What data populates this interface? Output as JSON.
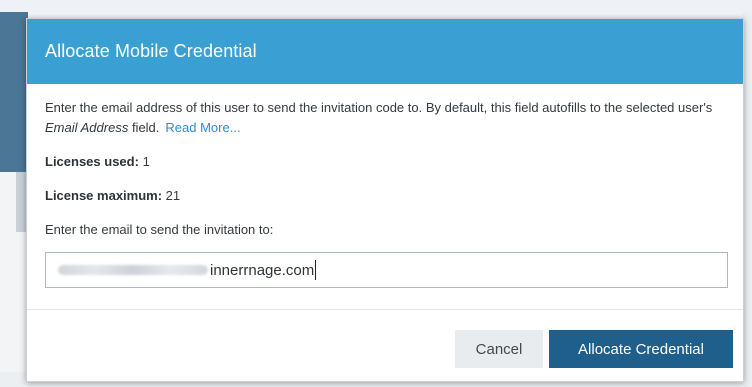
{
  "modal": {
    "title": "Allocate Mobile Credential",
    "description": {
      "text_before": "Enter the email address of this user to send the invitation code to. By default, this field autofills to the selected user's ",
      "emphasis": "Email Address",
      "text_after": " field.",
      "link": "Read More..."
    },
    "licenses_used": {
      "label": "Licenses used:",
      "value": "1"
    },
    "license_maximum": {
      "label": "License maximum:",
      "value": "21"
    },
    "email_prompt": "Enter the email to send the invitation to:",
    "email_input": {
      "value_visible": "innerrnage.com"
    },
    "buttons": {
      "cancel": "Cancel",
      "allocate": "Allocate Credential"
    }
  },
  "colors": {
    "header": "#3aa0d4",
    "primary_button": "#1f5f8c",
    "link": "#2a8fd0"
  }
}
